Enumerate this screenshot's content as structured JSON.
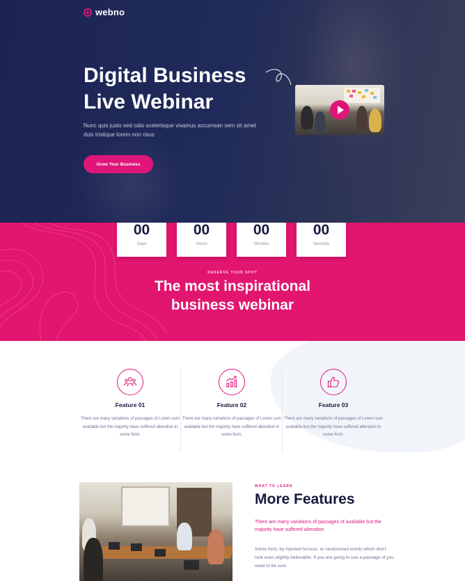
{
  "brand": {
    "name": "webno",
    "accent": "#e0157a",
    "navy": "#1c2452"
  },
  "hero": {
    "title_line1": "Digital Business",
    "title_line2": "Live Webinar",
    "text": "Nunc quis justo sed odio scelerisque vivamus accumsan sem sit amet duis tristique lorem non risus",
    "button_label": "Grow Your Business",
    "video_icon": "play-icon"
  },
  "countdown": [
    {
      "value": "00",
      "label": "Days"
    },
    {
      "value": "00",
      "label": "Hours"
    },
    {
      "value": "00",
      "label": "Minutes"
    },
    {
      "value": "00",
      "label": "Seconds"
    }
  ],
  "reserve": {
    "eyebrow": "RESERVE YOUR SPOT",
    "title_line1": "The most inspirational",
    "title_line2": "business webinar"
  },
  "features": [
    {
      "icon": "team-icon",
      "title": "Feature 01",
      "text": "There are many variations of passages of Lorem sum available but the majority have suffered alteration in some form."
    },
    {
      "icon": "growth-chart-icon",
      "title": "Feature 02",
      "text": "There are many variations of passages of Lorem sum available but the majority have suffered alteration in some form."
    },
    {
      "icon": "thumbs-up-icon",
      "title": "Feature 03",
      "text": "There are many variations of passages of Lorem sum available but the majority have suffered alteration in some form."
    }
  ],
  "more": {
    "eyebrow": "WHAT TO LEARN",
    "title": "More Features",
    "highlight": "There are many variations of passages of available but the majority have suffered alteration",
    "text": "Some form, by injected humour, or randomised words which don't look even slightly believable. If you are going to use a passage of you need to be sure"
  }
}
